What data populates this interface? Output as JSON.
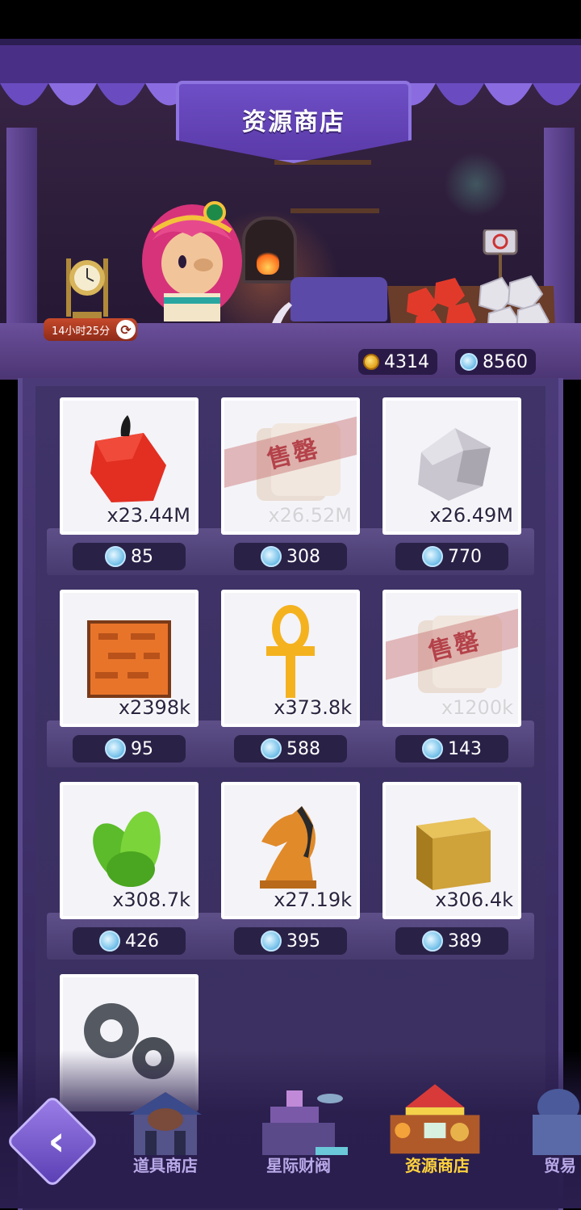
{
  "title": "资源商店",
  "timer": {
    "text": "14小时25分"
  },
  "currencies": {
    "coins": "4314",
    "gems": "8560"
  },
  "sold_out_label": "售罄",
  "items": [
    {
      "name": "red-crystal",
      "qty": "x23.44M",
      "price": "85",
      "sold_out": false
    },
    {
      "name": "scroll",
      "qty": "x26.52M",
      "price": "308",
      "sold_out": true
    },
    {
      "name": "stone",
      "qty": "x26.49M",
      "price": "770",
      "sold_out": false
    },
    {
      "name": "brick",
      "qty": "x2398k",
      "price": "95",
      "sold_out": false
    },
    {
      "name": "ankh",
      "qty": "x373.8k",
      "price": "588",
      "sold_out": false
    },
    {
      "name": "scroll",
      "qty": "x1200k",
      "price": "143",
      "sold_out": true
    },
    {
      "name": "leaf",
      "qty": "x308.7k",
      "price": "426",
      "sold_out": false
    },
    {
      "name": "knight",
      "qty": "x27.19k",
      "price": "395",
      "sold_out": false
    },
    {
      "name": "gold-cube",
      "qty": "x306.4k",
      "price": "389",
      "sold_out": false
    },
    {
      "name": "gears",
      "qty": "",
      "price": "",
      "sold_out": false
    }
  ],
  "nav": {
    "items": [
      {
        "label": "道具商店",
        "active": false
      },
      {
        "label": "星际财阀",
        "active": false
      },
      {
        "label": "资源商店",
        "active": true
      },
      {
        "label": "贸易",
        "active": false
      }
    ]
  },
  "colors": {
    "accent_active": "#ffd33d",
    "nav_inactive": "#b9a9e8",
    "sold_ribbon": "#b4424a"
  },
  "icons": {
    "back": "chevron-left-icon",
    "refresh": "refresh-icon",
    "coin": "coin-icon",
    "gem": "gem-icon"
  }
}
